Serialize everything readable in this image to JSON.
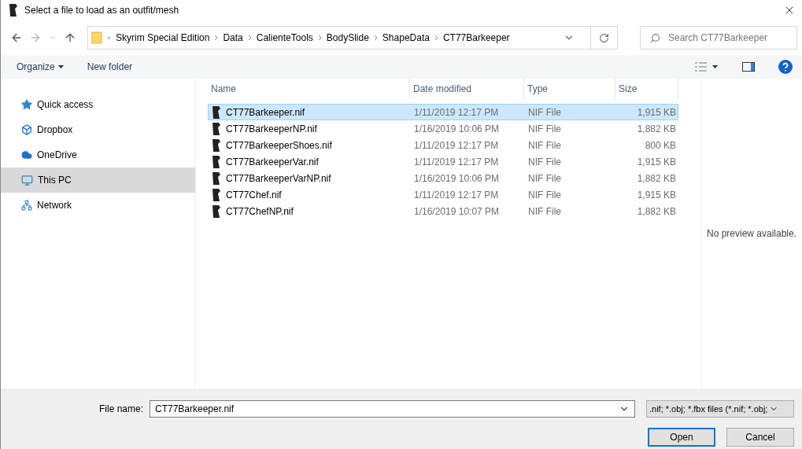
{
  "window": {
    "title": "Select a file to load as an outfit/mesh"
  },
  "breadcrumb": {
    "overflow": "«",
    "segments": [
      "Skyrim Special Edition",
      "Data",
      "CalienteTools",
      "BodySlide",
      "ShapeData",
      "CT77Barkeeper"
    ]
  },
  "search": {
    "placeholder": "Search CT77Barkeeper"
  },
  "toolbar": {
    "organize": "Organize",
    "new_folder": "New folder"
  },
  "sidebar": {
    "items": [
      {
        "label": "Quick access",
        "selected": false
      },
      {
        "label": "Dropbox",
        "selected": false
      },
      {
        "label": "OneDrive",
        "selected": false
      },
      {
        "label": "This PC",
        "selected": true
      },
      {
        "label": "Network",
        "selected": false
      }
    ]
  },
  "table": {
    "columns": [
      "Name",
      "Date modified",
      "Type",
      "Size"
    ],
    "rows": [
      {
        "name": "CT77Barkeeper.nif",
        "date": "1/11/2019 12:17 PM",
        "type": "NIF File",
        "size": "1,915 KB",
        "selected": true
      },
      {
        "name": "CT77BarkeeperNP.nif",
        "date": "1/16/2019 10:06 PM",
        "type": "NIF File",
        "size": "1,882 KB",
        "selected": false
      },
      {
        "name": "CT77BarkeeperShoes.nif",
        "date": "1/11/2019 12:17 PM",
        "type": "NIF File",
        "size": "800 KB",
        "selected": false
      },
      {
        "name": "CT77BarkeeperVar.nif",
        "date": "1/11/2019 12:17 PM",
        "type": "NIF File",
        "size": "1,915 KB",
        "selected": false
      },
      {
        "name": "CT77BarkeeperVarNP.nif",
        "date": "1/16/2019 10:06 PM",
        "type": "NIF File",
        "size": "1,882 KB",
        "selected": false
      },
      {
        "name": "CT77Chef.nif",
        "date": "1/11/2019 12:17 PM",
        "type": "NIF File",
        "size": "1,915 KB",
        "selected": false
      },
      {
        "name": "CT77ChefNP.nif",
        "date": "1/16/2019 10:07 PM",
        "type": "NIF File",
        "size": "1,882 KB",
        "selected": false
      }
    ]
  },
  "preview": {
    "message": "No preview available."
  },
  "footer": {
    "file_name_label": "File name:",
    "file_name": "CT77Barkeeper.nif",
    "filter": ".nif; *.obj; *.fbx files (*.nif; *.obj;",
    "buttons": [
      "Open",
      "Cancel"
    ]
  }
}
